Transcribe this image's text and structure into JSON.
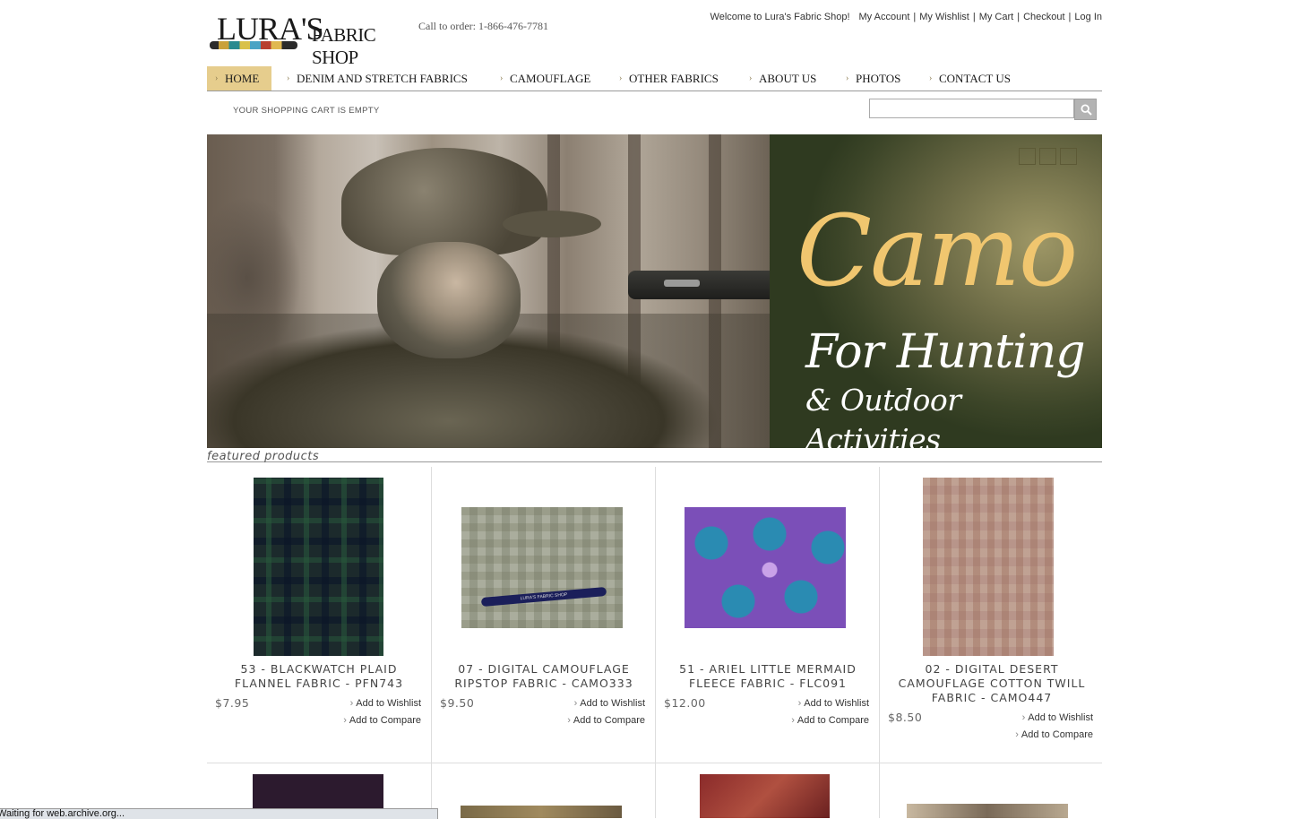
{
  "header": {
    "logo_text_main": "LURA'S",
    "logo_text_shop": "FABRIC SHOP",
    "call_to_order": "Call to order: 1-866-476-7781",
    "welcome": "Welcome to Lura's Fabric Shop!",
    "links": [
      "My Account",
      "My Wishlist",
      "My Cart",
      "Checkout",
      "Log In"
    ]
  },
  "nav": {
    "items": [
      "HOME",
      "DENIM AND STRETCH FABRICS",
      "CAMOUFLAGE",
      "OTHER FABRICS",
      "ABOUT US",
      "PHOTOS",
      "CONTACT US"
    ],
    "active": "HOME"
  },
  "cart": {
    "status": "YOUR SHOPPING CART IS EMPTY"
  },
  "search": {
    "placeholder": "",
    "value": ""
  },
  "banner": {
    "headline": "Camo",
    "subline1": "For Hunting",
    "subline2": "& Outdoor Activities",
    "slide_count": 3
  },
  "featured": {
    "heading": "featured products"
  },
  "products": [
    {
      "name": "53 - BLACKWATCH PLAID FLANNEL FABRIC - PFN743",
      "price": "$7.95",
      "wishlist": "Add to Wishlist",
      "compare": "Add to Compare"
    },
    {
      "name": "07 - DIGITAL CAMOUFLAGE RIPSTOP FABRIC - CAMO333",
      "price": "$9.50",
      "wishlist": "Add to Wishlist",
      "compare": "Add to Compare"
    },
    {
      "name": "51 - ARIEL LITTLE MERMAID FLEECE FABRIC - FLC091",
      "price": "$12.00",
      "wishlist": "Add to Wishlist",
      "compare": "Add to Compare"
    },
    {
      "name": "02 - DIGITAL DESERT CAMOUFLAGE COTTON TWILL FABRIC - CAMO447",
      "price": "$8.50",
      "wishlist": "Add to Wishlist",
      "compare": "Add to Compare"
    }
  ],
  "pen_text": "LURA'S FABRIC SHOP",
  "status_bar": {
    "text": "Waiting for web.archive.org..."
  },
  "colors": {
    "nav_active": "#e6cd8d",
    "promo_gold": "#f0c66f",
    "promo_green": "#3c4528"
  }
}
